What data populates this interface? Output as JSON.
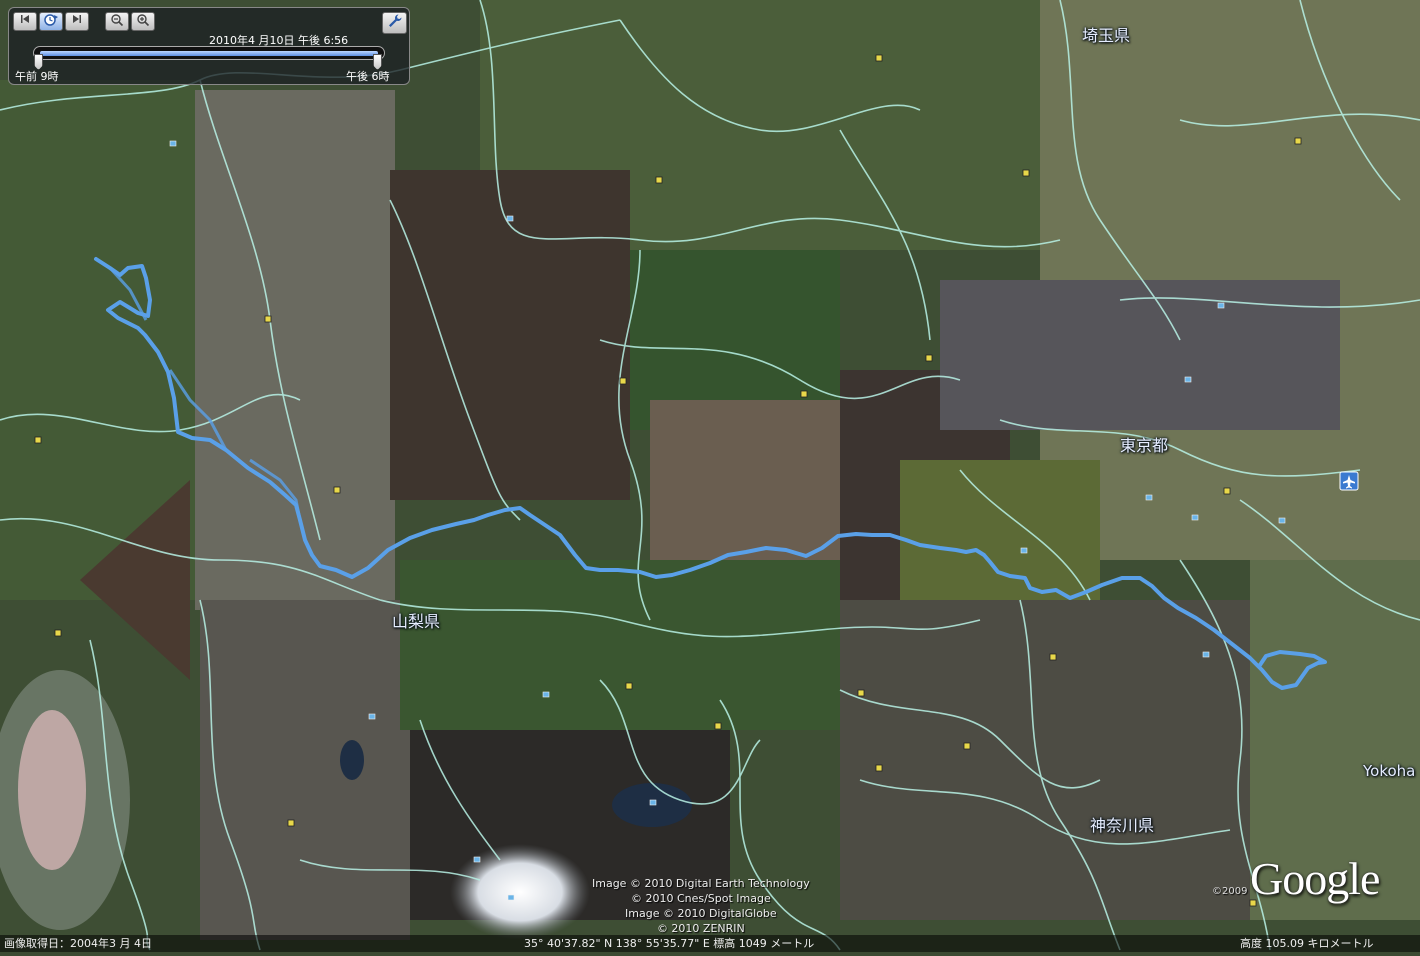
{
  "map": {
    "labels": {
      "saitama": "埼玉県",
      "tokyo": "東京都",
      "yamanashi": "山梨県",
      "kanagawa": "神奈川県",
      "yokohama": "Yokoha"
    },
    "route_color": "#5aa0e8",
    "border_color": "#b8f2e6"
  },
  "time_slider": {
    "current": "2010年4 月10日  午後   6:56",
    "start_label": "午前   9時",
    "end_label": "午後   6時",
    "position": 0.98
  },
  "icons": {
    "prev": "skip-back-icon",
    "play": "clock-play-icon",
    "next": "skip-forward-icon",
    "zoom_out": "zoom-out-icon",
    "zoom_in": "zoom-in-icon",
    "settings": "wrench-icon",
    "airport": "airplane-icon"
  },
  "attribution": {
    "line1": "Image © 2010 Digital Earth Technology",
    "line2": "© 2010 Cnes/Spot Image",
    "line3": "Image © 2010 DigitalGlobe",
    "line4": "© 2010 ZENRIN",
    "year": "©2009",
    "logo": "Google"
  },
  "status": {
    "imagery_date": "画像取得日：2004年3 月 4日",
    "coordinates": "35° 40'37.82\" N    138° 55'35.77\" E  標高 1049 メートル",
    "altitude": "高度   105.09 キロメートル"
  }
}
